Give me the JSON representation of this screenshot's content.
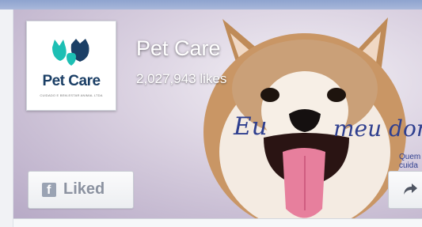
{
  "page": {
    "name": "Pet Care",
    "likes": "2,027,943 likes"
  },
  "profile": {
    "logo_text": "Pet Care",
    "logo_tagline": "CUIDADO E BEM-ESTAR ANIMAL LTDA",
    "logo_icon": "cat-dog-heart-logo-icon"
  },
  "cover": {
    "script_left": "Eu",
    "script_right": "meu don",
    "side_note": "Quem\ncuida"
  },
  "actions": {
    "liked_label": "Liked",
    "liked_icon": "facebook-icon",
    "share_icon": "share-arrow-icon"
  },
  "colors": {
    "script": "#2f3f8f",
    "logo_teal": "#1dbfb4",
    "logo_navy": "#1b3f66"
  }
}
